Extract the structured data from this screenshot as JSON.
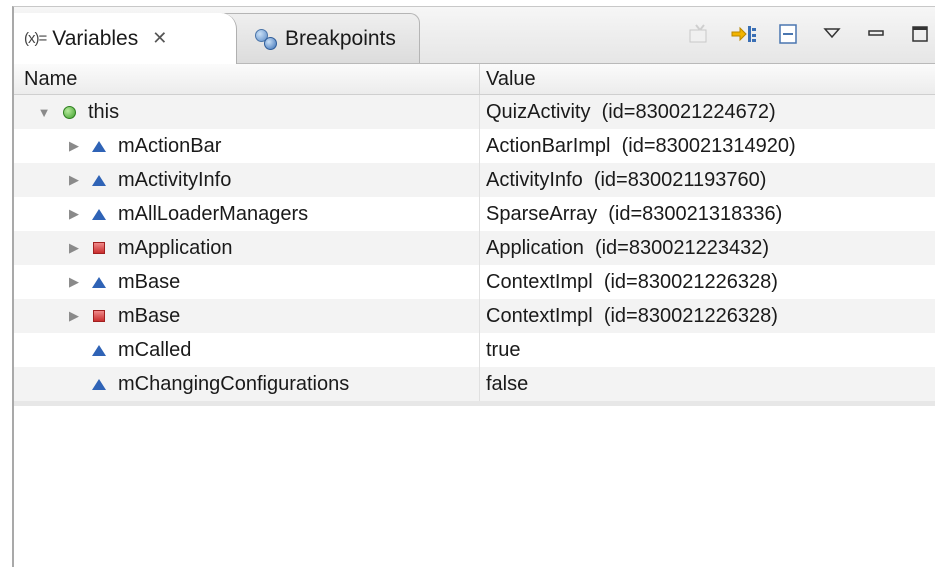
{
  "tabs": [
    {
      "label": "Variables",
      "icon": "variables-icon"
    },
    {
      "label": "Breakpoints",
      "icon": "breakpoints-icon"
    }
  ],
  "table": {
    "headers": {
      "name": "Name",
      "value": "Value"
    },
    "rows": [
      {
        "name": "this",
        "value": "QuizActivity  (id=830021224672)",
        "marker": "green-circle",
        "twisty": "expanded"
      },
      {
        "name": "mActionBar",
        "value": "ActionBarImpl  (id=830021314920)",
        "marker": "blue-triangle",
        "twisty": "collapsed"
      },
      {
        "name": "mActivityInfo",
        "value": "ActivityInfo  (id=830021193760)",
        "marker": "blue-triangle",
        "twisty": "collapsed"
      },
      {
        "name": "mAllLoaderManagers",
        "value": "SparseArray  (id=830021318336)",
        "marker": "blue-triangle",
        "twisty": "collapsed"
      },
      {
        "name": "mApplication",
        "value": "Application  (id=830021223432)",
        "marker": "red-square",
        "twisty": "collapsed"
      },
      {
        "name": "mBase",
        "value": "ContextImpl  (id=830021226328)",
        "marker": "blue-triangle",
        "twisty": "collapsed"
      },
      {
        "name": "mBase",
        "value": "ContextImpl  (id=830021226328)",
        "marker": "red-square",
        "twisty": "collapsed"
      },
      {
        "name": "mCalled",
        "value": "true",
        "marker": "blue-triangle",
        "twisty": "none"
      },
      {
        "name": "mChangingConfigurations",
        "value": "false",
        "marker": "blue-triangle",
        "twisty": "none"
      }
    ]
  }
}
